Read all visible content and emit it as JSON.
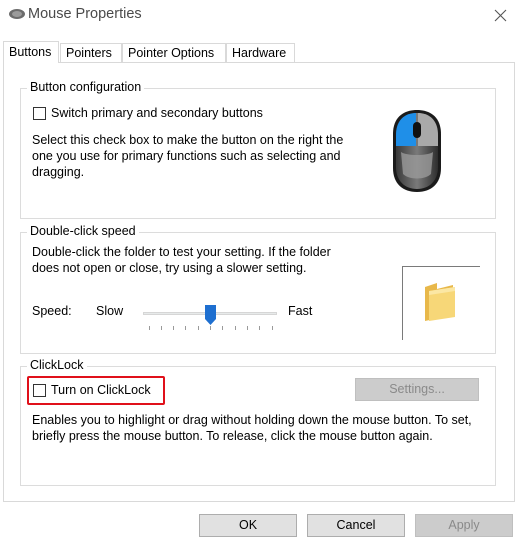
{
  "window": {
    "title": "Mouse Properties",
    "icon": "mouse-icon",
    "close_glyph": "✕"
  },
  "tabs": [
    {
      "label": "Buttons",
      "active": true
    },
    {
      "label": "Pointers",
      "active": false
    },
    {
      "label": "Pointer Options",
      "active": false
    },
    {
      "label": "Hardware",
      "active": false
    }
  ],
  "button_configuration": {
    "legend": "Button configuration",
    "checkbox_label": "Switch primary and secondary buttons",
    "checked": false,
    "description": "Select this check box to make the button on the right the one you use for primary functions such as selecting and dragging.",
    "image_icon": "mouse-icon"
  },
  "double_click": {
    "legend": "Double-click speed",
    "description": "Double-click the folder to test your setting. If the folder does not open or close, try using a slower setting.",
    "speed_label": "Speed:",
    "slow_label": "Slow",
    "fast_label": "Fast",
    "slider_position_fraction": 0.5,
    "tick_count": 11,
    "folder_icon": "folder-icon"
  },
  "clicklock": {
    "legend": "ClickLock",
    "checkbox_label": "Turn on ClickLock",
    "checked": false,
    "settings_label": "Settings...",
    "description": "Enables you to highlight or drag without holding down the mouse button. To set, briefly press the mouse button. To release, click the mouse button again."
  },
  "footer": {
    "ok_label": "OK",
    "cancel_label": "Cancel",
    "apply_label": "Apply"
  },
  "colors": {
    "highlight": "#e0101a",
    "mouse_accent": "#1f8fe8",
    "slider_thumb": "#1e6fd0"
  }
}
